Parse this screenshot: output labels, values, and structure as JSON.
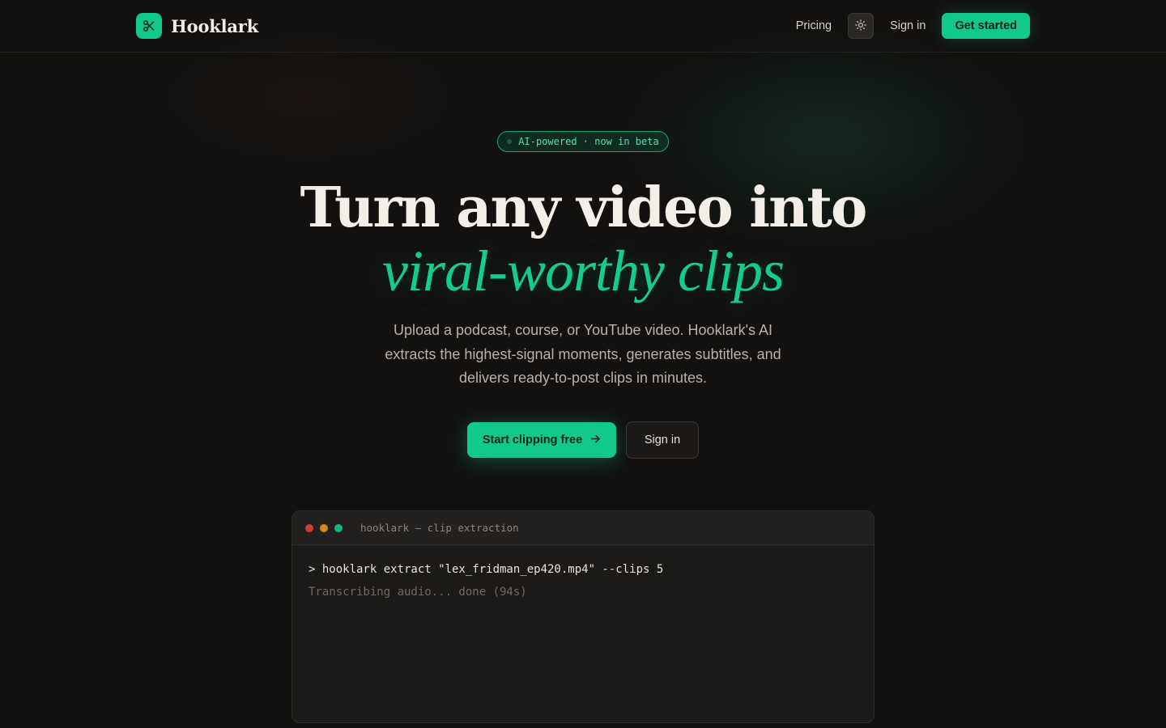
{
  "brand": {
    "name": "Hooklark",
    "logo_icon": "scissors-icon",
    "accent_color": "#12c98c"
  },
  "nav": {
    "pricing": "Pricing",
    "theme_icon": "sun-icon",
    "sign_in": "Sign in",
    "get_started": "Get started"
  },
  "hero": {
    "badge": "AI-powered · now in beta",
    "headline": "Turn any video into",
    "headline_accent": "viral-worthy clips",
    "subhead": "Upload a podcast, course, or YouTube video. Hooklark's AI extracts the highest-signal moments, generates subtitles, and delivers ready-to-post clips in minutes.",
    "cta_primary": "Start clipping free",
    "cta_primary_icon": "arrow-right-icon",
    "cta_secondary": "Sign in"
  },
  "terminal": {
    "title": "hooklark — clip extraction",
    "window_dots": [
      "#c7403c",
      "#d08a1a",
      "#14b57e"
    ],
    "command": "> hooklark extract \"lex_fridman_ep420.mp4\" --clips 5",
    "output": "Transcribing audio... done (94s)"
  }
}
